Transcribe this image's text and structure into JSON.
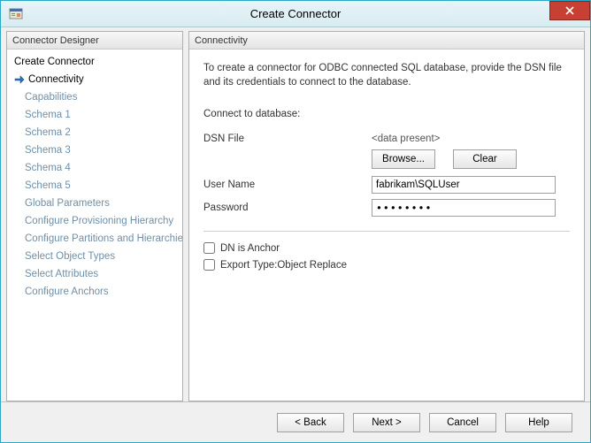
{
  "window": {
    "title": "Create Connector"
  },
  "sidebar": {
    "header": "Connector Designer",
    "items": [
      {
        "label": "Create Connector",
        "level": 0,
        "state": "done"
      },
      {
        "label": "Connectivity",
        "level": 0,
        "state": "current"
      },
      {
        "label": "Capabilities",
        "level": 1,
        "state": "pending"
      },
      {
        "label": "Schema 1",
        "level": 1,
        "state": "pending"
      },
      {
        "label": "Schema 2",
        "level": 1,
        "state": "pending"
      },
      {
        "label": "Schema 3",
        "level": 1,
        "state": "pending"
      },
      {
        "label": "Schema 4",
        "level": 1,
        "state": "pending"
      },
      {
        "label": "Schema 5",
        "level": 1,
        "state": "pending"
      },
      {
        "label": "Global Parameters",
        "level": 1,
        "state": "pending"
      },
      {
        "label": "Configure Provisioning Hierarchy",
        "level": 1,
        "state": "pending"
      },
      {
        "label": "Configure Partitions and Hierarchies",
        "level": 1,
        "state": "pending"
      },
      {
        "label": "Select Object Types",
        "level": 1,
        "state": "pending"
      },
      {
        "label": "Select Attributes",
        "level": 1,
        "state": "pending"
      },
      {
        "label": "Configure Anchors",
        "level": 1,
        "state": "pending"
      }
    ]
  },
  "content": {
    "header": "Connectivity",
    "intro": "To create a connector for ODBC connected SQL database, provide the DSN file and its credentials to connect to the database.",
    "section_label": "Connect to database:",
    "dsn": {
      "label": "DSN File",
      "value": "<data present>",
      "browse": "Browse...",
      "clear": "Clear"
    },
    "username": {
      "label": "User Name",
      "value": "fabrikam\\SQLUser"
    },
    "password": {
      "label": "Password",
      "value": "••••••••"
    },
    "checks": {
      "dn_anchor": "DN is Anchor",
      "export_type": "Export Type:Object Replace"
    }
  },
  "footer": {
    "back": "<  Back",
    "next": "Next  >",
    "cancel": "Cancel",
    "help": "Help"
  }
}
